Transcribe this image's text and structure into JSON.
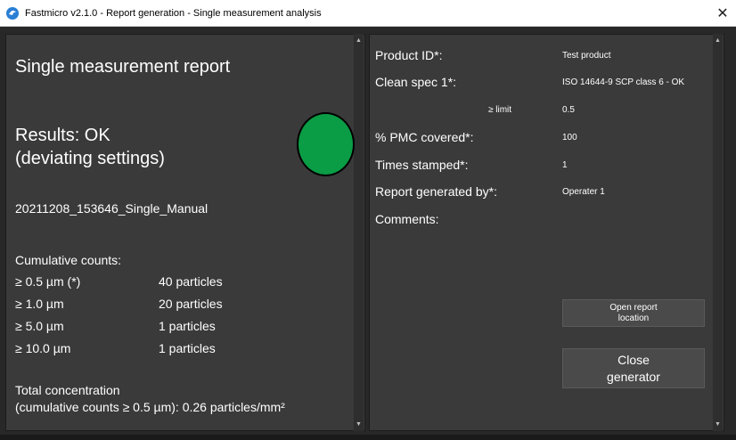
{
  "window": {
    "title": "Fastmicro v2.1.0 - Report generation - Single measurement analysis",
    "close_symbol": "✕"
  },
  "colors": {
    "status_ok": "#0a9d45",
    "panel_bg": "#3a3a3a"
  },
  "left": {
    "report_title": "Single measurement report",
    "results_line1": "Results: OK",
    "results_line2": "(deviating settings)",
    "status_light_icon": "status-ok-icon",
    "measurement_id": "20211208_153646_Single_Manual",
    "cumulative_title": "Cumulative counts:",
    "cumulative": [
      {
        "label": "≥ 0.5 µm (*)",
        "value": "40 particles"
      },
      {
        "label": "≥ 1.0 µm",
        "value": "20 particles"
      },
      {
        "label": "≥ 5.0 µm",
        "value": "1 particles"
      },
      {
        "label": "≥ 10.0 µm",
        "value": "1 particles"
      }
    ],
    "total_line1": "Total concentration",
    "total_line2": "(cumulative counts ≥ 0.5 µm): 0.26 particles/mm²"
  },
  "right": {
    "product_id_label": "Product ID*:",
    "product_id_value": "Test product",
    "clean_spec_label": "Clean spec 1*:",
    "clean_spec_value": "ISO 14644-9 SCP class 6 - OK",
    "limit_label": "≥ limit",
    "limit_value": "0.5",
    "pmc_label": "% PMC covered*:",
    "pmc_value": "100",
    "stamped_label": "Times stamped*:",
    "stamped_value": "1",
    "generated_by_label": "Report generated by*:",
    "generated_by_value": "Operater 1",
    "comments_label": "Comments:",
    "open_report_line1": "Open report",
    "open_report_line2": "location",
    "close_line1": "Close",
    "close_line2": "generator"
  }
}
